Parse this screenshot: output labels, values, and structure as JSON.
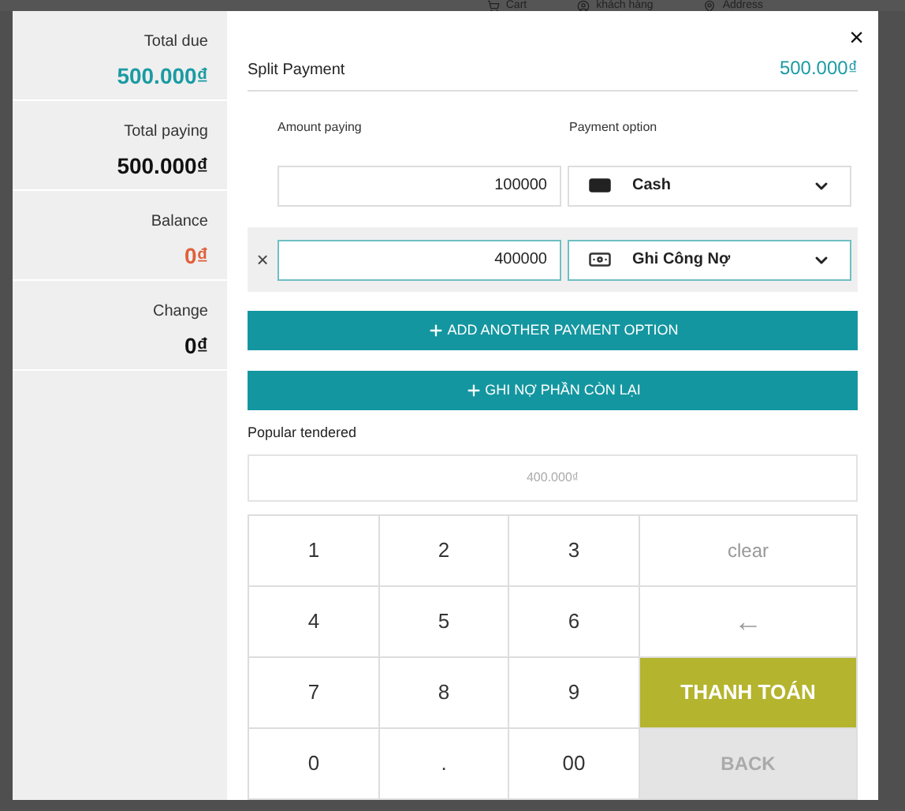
{
  "background_header": [
    {
      "kind": "cart",
      "label": "Cart"
    },
    {
      "kind": "customer",
      "label": "khách hàng"
    },
    {
      "kind": "address",
      "label": "Address"
    }
  ],
  "summary": [
    {
      "label": "Total due",
      "value": "500.000₫",
      "color": "#1a9ba3"
    },
    {
      "label": "Total paying",
      "value": "500.000₫",
      "color": "#111111"
    },
    {
      "label": "Balance",
      "value": "0₫",
      "color": "#e0603a"
    },
    {
      "label": "Change",
      "value": "0₫",
      "color": "#111111"
    }
  ],
  "split_payment": {
    "title": "Split Payment",
    "total": "500.000₫",
    "close": "×",
    "columns": [
      "Amount paying",
      "Payment option"
    ],
    "rows": [
      {
        "amount": "100000",
        "method": "Cash",
        "kind": "cash",
        "removable": false,
        "selected": false
      },
      {
        "amount": "400000",
        "method": "Ghi Công Nợ",
        "kind": "debt",
        "removable": true,
        "selected": true
      }
    ],
    "remove": "×"
  },
  "actions": [
    {
      "label": "ADD ANOTHER PAYMENT OPTION"
    },
    {
      "label": "GHI NỢ PHẦN CÒN LẠI"
    }
  ],
  "popular_tendered": {
    "label": "Popular tendered",
    "options": [
      "400.000₫"
    ]
  },
  "keypad": [
    {
      "kind": "digit",
      "label": "1"
    },
    {
      "kind": "digit",
      "label": "2"
    },
    {
      "kind": "digit",
      "label": "3"
    },
    {
      "kind": "clear",
      "label": "clear"
    },
    {
      "kind": "digit",
      "label": "4"
    },
    {
      "kind": "digit",
      "label": "5"
    },
    {
      "kind": "digit",
      "label": "6"
    },
    {
      "kind": "backspace",
      "label": "←"
    },
    {
      "kind": "digit",
      "label": "7"
    },
    {
      "kind": "digit",
      "label": "8"
    },
    {
      "kind": "digit",
      "label": "9"
    },
    {
      "kind": "pay",
      "label": "THANH TOÁN"
    },
    {
      "kind": "digit",
      "label": "0"
    },
    {
      "kind": "digit",
      "label": "."
    },
    {
      "kind": "digit",
      "label": "00"
    },
    {
      "kind": "back",
      "label": "BACK"
    }
  ]
}
